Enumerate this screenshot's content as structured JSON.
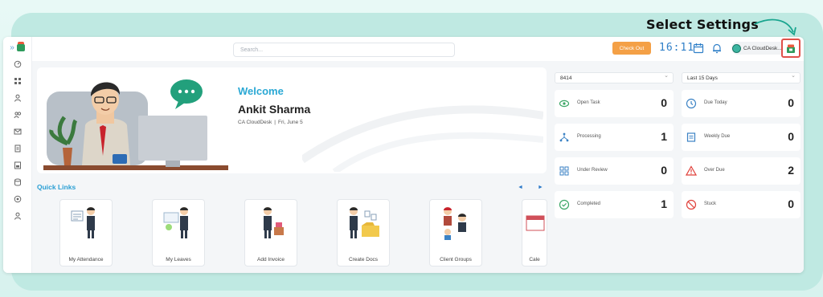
{
  "annotation": {
    "text": "Select Settings"
  },
  "topbar": {
    "search_placeholder": "Search...",
    "checkout_label": "Check Out",
    "clock": "16:11",
    "user_name": "CA CloudDesk..."
  },
  "welcome": {
    "title": "Welcome",
    "name": "Ankit Sharma",
    "org": "CA CloudDesk",
    "separator": "|",
    "date": "Fri, June 5"
  },
  "quick_links": {
    "title": "Quick Links",
    "prev": "◄",
    "next": "►",
    "items": [
      {
        "label": "My Attendance"
      },
      {
        "label": "My Leaves"
      },
      {
        "label": "Add Invoice"
      },
      {
        "label": "Create Docs"
      },
      {
        "label": "Client Groups"
      },
      {
        "label": "Cale"
      }
    ]
  },
  "filters": {
    "left": "8414",
    "right": "Last 15 Days"
  },
  "stats": {
    "left": [
      {
        "label": "Open Task",
        "value": "0",
        "icon": "eye-icon",
        "color": "#3aa565"
      },
      {
        "label": "Processing",
        "value": "1",
        "icon": "processing-icon",
        "color": "#3b82c4"
      },
      {
        "label": "Under Review",
        "value": "0",
        "icon": "review-icon",
        "color": "#3b82c4"
      },
      {
        "label": "Completed",
        "value": "1",
        "icon": "check-circle-icon",
        "color": "#3aa565"
      }
    ],
    "right": [
      {
        "label": "Due Today",
        "value": "0",
        "icon": "clock-icon",
        "color": "#3b82c4"
      },
      {
        "label": "Weekly Due",
        "value": "0",
        "icon": "calendar-week-icon",
        "color": "#3b82c4"
      },
      {
        "label": "Over Due",
        "value": "2",
        "icon": "warning-icon",
        "color": "#e0403a"
      },
      {
        "label": "Stuck",
        "value": "0",
        "icon": "blocked-icon",
        "color": "#e0403a"
      }
    ]
  },
  "colors": {
    "accent": "#2aa8d4",
    "checkout": "#f4a046",
    "highlight": "#e0504a",
    "background": "#bfe9e2"
  }
}
